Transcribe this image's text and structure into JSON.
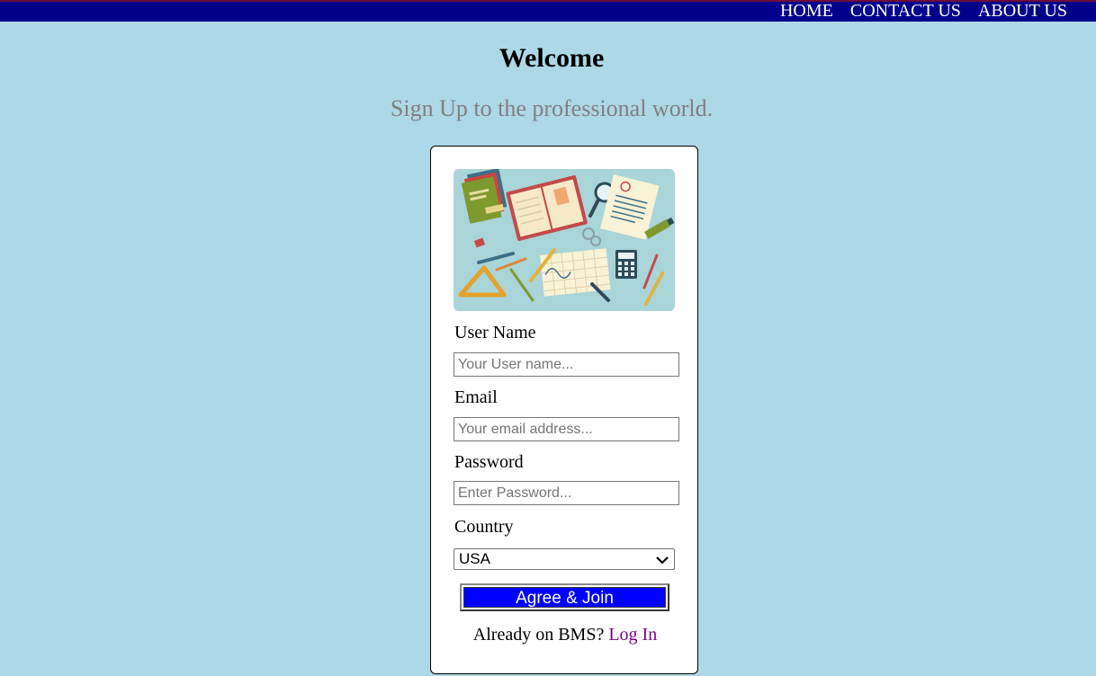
{
  "nav": {
    "links": [
      "HOME",
      "CONTACT US",
      "ABOUT US"
    ]
  },
  "header": {
    "title": "Welcome",
    "subtitle": "Sign Up to the professional world."
  },
  "form": {
    "username_label": "User Name",
    "username_placeholder": "Your User name...",
    "email_label": "Email",
    "email_placeholder": "Your email address...",
    "password_label": "Password",
    "password_placeholder": "Enter Password...",
    "country_label": "Country",
    "country_selected": "USA",
    "submit_label": "Agree & Join",
    "already_text": "Already on BMS?",
    "login_link": "Log In"
  },
  "colors": {
    "page_bg": "#add8e6",
    "nav_bg": "#00008b",
    "button_bg": "#0000ff",
    "link": "#800080",
    "subtitle": "#808080"
  }
}
